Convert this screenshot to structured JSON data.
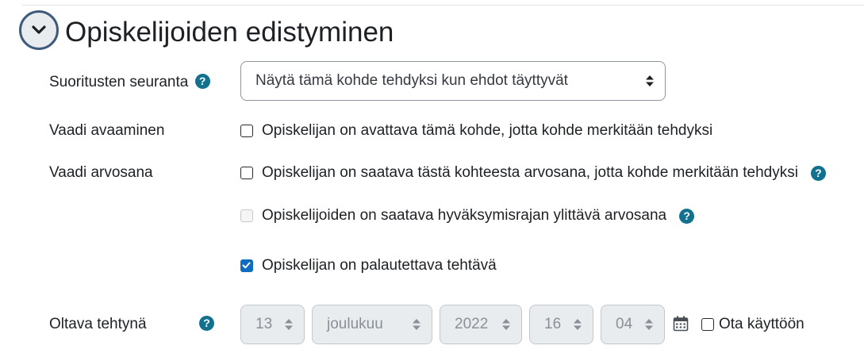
{
  "section": {
    "title": "Opiskelijoiden edistyminen"
  },
  "completion_tracking": {
    "label": "Suoritusten seuranta",
    "selected": "Näytä tämä kohde tehdyksi kun ehdot täyttyvät"
  },
  "require_view": {
    "label": "Vaadi avaaminen",
    "checkbox_label": "Opiskelijan on avattava tämä kohde, jotta kohde merkitään tehdyksi",
    "checked": false
  },
  "require_grade": {
    "label": "Vaadi arvosana",
    "checkbox_label": "Opiskelijan on saatava tästä kohteesta arvosana, jotta kohde merkitään tehdyksi",
    "checked": false,
    "pass_grade_label": "Opiskelijoiden on saatava hyväksymisrajan ylittävä arvosana",
    "pass_grade_checked": false,
    "pass_grade_disabled": true,
    "submit_label": "Opiskelijan on palautettava tehtävä",
    "submit_checked": true
  },
  "expected_completion": {
    "label": "Oltava tehtynä",
    "day": "13",
    "month": "joulukuu",
    "year": "2022",
    "hour": "16",
    "minute": "04",
    "enable_label": "Ota käyttöön",
    "enabled": false
  },
  "icons": {
    "collapse": "chevron-down-icon",
    "help": "help-circle-icon",
    "calendar": "calendar-icon",
    "select_arrows": "select-arrows-icon"
  },
  "colors": {
    "help_icon": "#11718f",
    "checkbox_checked": "#0f6cbf",
    "collapse_border": "#3f5a7a"
  }
}
